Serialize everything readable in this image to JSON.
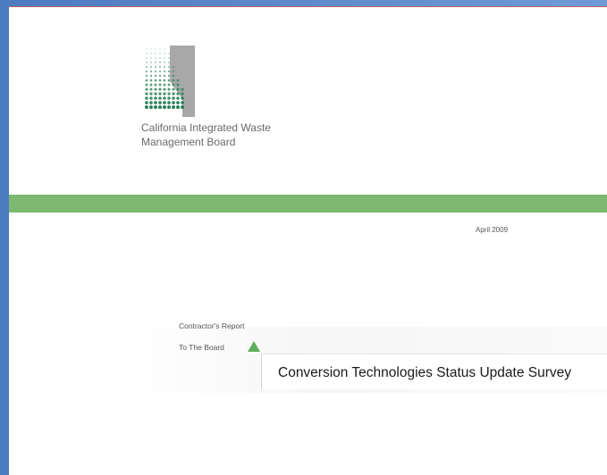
{
  "organization": {
    "name_line1": "California Integrated Waste",
    "name_line2": "Management Board",
    "logo_icon": "ciwmb-logo-icon"
  },
  "report": {
    "date": "April 2009",
    "type": "Contractor's Report",
    "audience": "To The Board",
    "title": "Conversion Technologies Status Update Survey"
  },
  "colors": {
    "band": "#7fb871",
    "logo_green": "#1e7a4f",
    "logo_gray": "#a8a8a8",
    "frame": "#5b86c4"
  }
}
